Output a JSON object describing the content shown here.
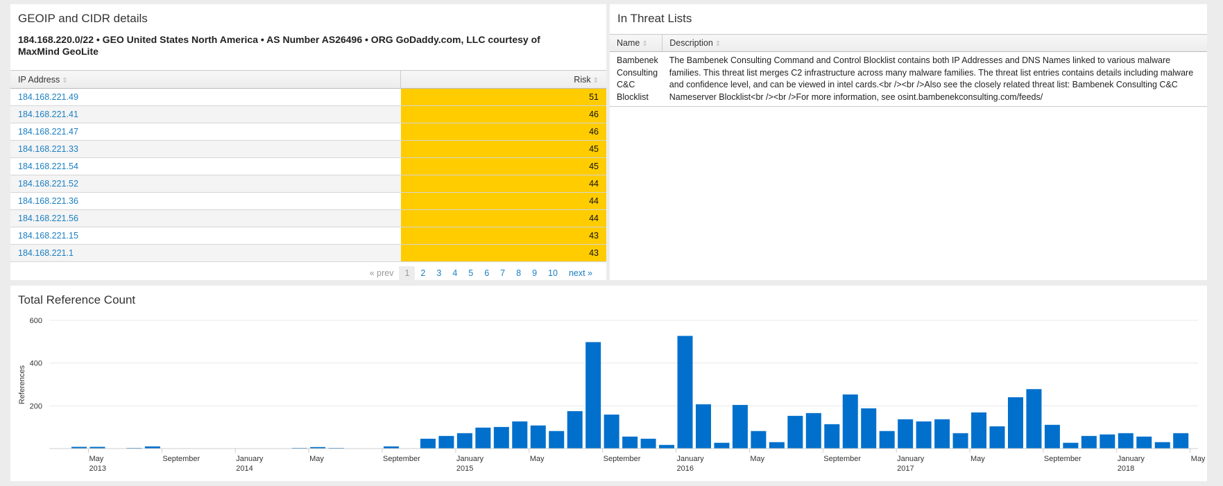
{
  "geo_panel": {
    "title": "GEOIP and CIDR details",
    "subtitle": "184.168.220.0/22 • GEO United States North America • AS Number AS26496 • ORG GoDaddy.com, LLC courtesy of MaxMind GeoLite",
    "columns": {
      "ip": "IP Address",
      "risk": "Risk"
    },
    "risk_color": "#ffcc00",
    "link_color": "#1a7fc1",
    "rows": [
      {
        "ip": "184.168.221.49",
        "risk": "51"
      },
      {
        "ip": "184.168.221.41",
        "risk": "46"
      },
      {
        "ip": "184.168.221.47",
        "risk": "46"
      },
      {
        "ip": "184.168.221.33",
        "risk": "45"
      },
      {
        "ip": "184.168.221.54",
        "risk": "45"
      },
      {
        "ip": "184.168.221.52",
        "risk": "44"
      },
      {
        "ip": "184.168.221.36",
        "risk": "44"
      },
      {
        "ip": "184.168.221.56",
        "risk": "44"
      },
      {
        "ip": "184.168.221.15",
        "risk": "43"
      },
      {
        "ip": "184.168.221.1",
        "risk": "43"
      }
    ],
    "pagination": {
      "prev": "« prev",
      "pages": [
        "1",
        "2",
        "3",
        "4",
        "5",
        "6",
        "7",
        "8",
        "9",
        "10"
      ],
      "current": "1",
      "next": "next »"
    }
  },
  "threat_panel": {
    "title": "In Threat Lists",
    "columns": {
      "name": "Name",
      "description": "Description"
    },
    "rows": [
      {
        "name": "Bambenek Consulting C&C Blocklist",
        "description": "The Bambenek Consulting Command and Control Blocklist contains both IP Addresses and DNS Names linked to various malware families. This threat list merges C2 infrastructure across many malware families. The threat list entries contains details including malware and confidence level, and can be viewed in intel cards.<br /><br />Also see the closely related threat list: Bambenek Consulting C&C Nameserver Blocklist<br /><br />For more information, see osint.bambenekconsulting.com/feeds/"
      }
    ]
  },
  "reference_panel": {
    "title": "Total Reference Count"
  },
  "chart_data": {
    "type": "bar",
    "title": "Total Reference Count",
    "xlabel": "",
    "ylabel": "References",
    "ylim": [
      0,
      600
    ],
    "yticks": [
      "200",
      "400",
      "600"
    ],
    "grid": true,
    "bar_color": "#0070cc",
    "x": [
      "2013-04",
      "2013-05",
      "2013-06",
      "2013-07",
      "2013-08",
      "2013-09",
      "2013-10",
      "2013-11",
      "2013-12",
      "2014-01",
      "2014-02",
      "2014-03",
      "2014-04",
      "2014-05",
      "2014-06",
      "2014-07",
      "2014-08",
      "2014-09",
      "2014-10",
      "2014-11",
      "2014-12",
      "2015-01",
      "2015-02",
      "2015-03",
      "2015-04",
      "2015-05",
      "2015-06",
      "2015-07",
      "2015-08",
      "2015-09",
      "2015-10",
      "2015-11",
      "2015-12",
      "2016-01",
      "2016-02",
      "2016-03",
      "2016-04",
      "2016-05",
      "2016-06",
      "2016-07",
      "2016-08",
      "2016-09",
      "2016-10",
      "2016-11",
      "2016-12",
      "2017-01",
      "2017-02",
      "2017-03",
      "2017-04",
      "2017-05",
      "2017-06",
      "2017-07",
      "2017-08",
      "2017-09",
      "2017-10",
      "2017-11",
      "2017-12",
      "2018-01",
      "2018-02",
      "2018-03",
      "2018-04"
    ],
    "values": [
      8,
      8,
      0,
      3,
      10,
      0,
      0,
      0,
      0,
      0,
      0,
      0,
      3,
      7,
      3,
      0,
      0,
      10,
      0,
      46,
      59,
      72,
      98,
      101,
      127,
      108,
      82,
      175,
      498,
      159,
      56,
      46,
      17,
      527,
      207,
      27,
      204,
      82,
      30,
      153,
      166,
      114,
      253,
      188,
      82,
      137,
      127,
      137,
      72,
      169,
      104,
      240,
      278,
      111,
      27,
      59,
      66,
      72,
      56,
      30,
      72
    ],
    "xticks": [
      {
        "month": "2013-05",
        "label": "May",
        "year": "2013"
      },
      {
        "month": "2013-09",
        "label": "September",
        "year": ""
      },
      {
        "month": "2014-01",
        "label": "January",
        "year": "2014"
      },
      {
        "month": "2014-05",
        "label": "May",
        "year": ""
      },
      {
        "month": "2014-09",
        "label": "September",
        "year": ""
      },
      {
        "month": "2015-01",
        "label": "January",
        "year": "2015"
      },
      {
        "month": "2015-05",
        "label": "May",
        "year": ""
      },
      {
        "month": "2015-09",
        "label": "September",
        "year": ""
      },
      {
        "month": "2016-01",
        "label": "January",
        "year": "2016"
      },
      {
        "month": "2016-05",
        "label": "May",
        "year": ""
      },
      {
        "month": "2016-09",
        "label": "September",
        "year": ""
      },
      {
        "month": "2017-01",
        "label": "January",
        "year": "2017"
      },
      {
        "month": "2017-05",
        "label": "May",
        "year": ""
      },
      {
        "month": "2017-09",
        "label": "September",
        "year": ""
      },
      {
        "month": "2018-01",
        "label": "January",
        "year": "2018"
      },
      {
        "month": "2018-05",
        "label": "May",
        "year": ""
      }
    ]
  }
}
